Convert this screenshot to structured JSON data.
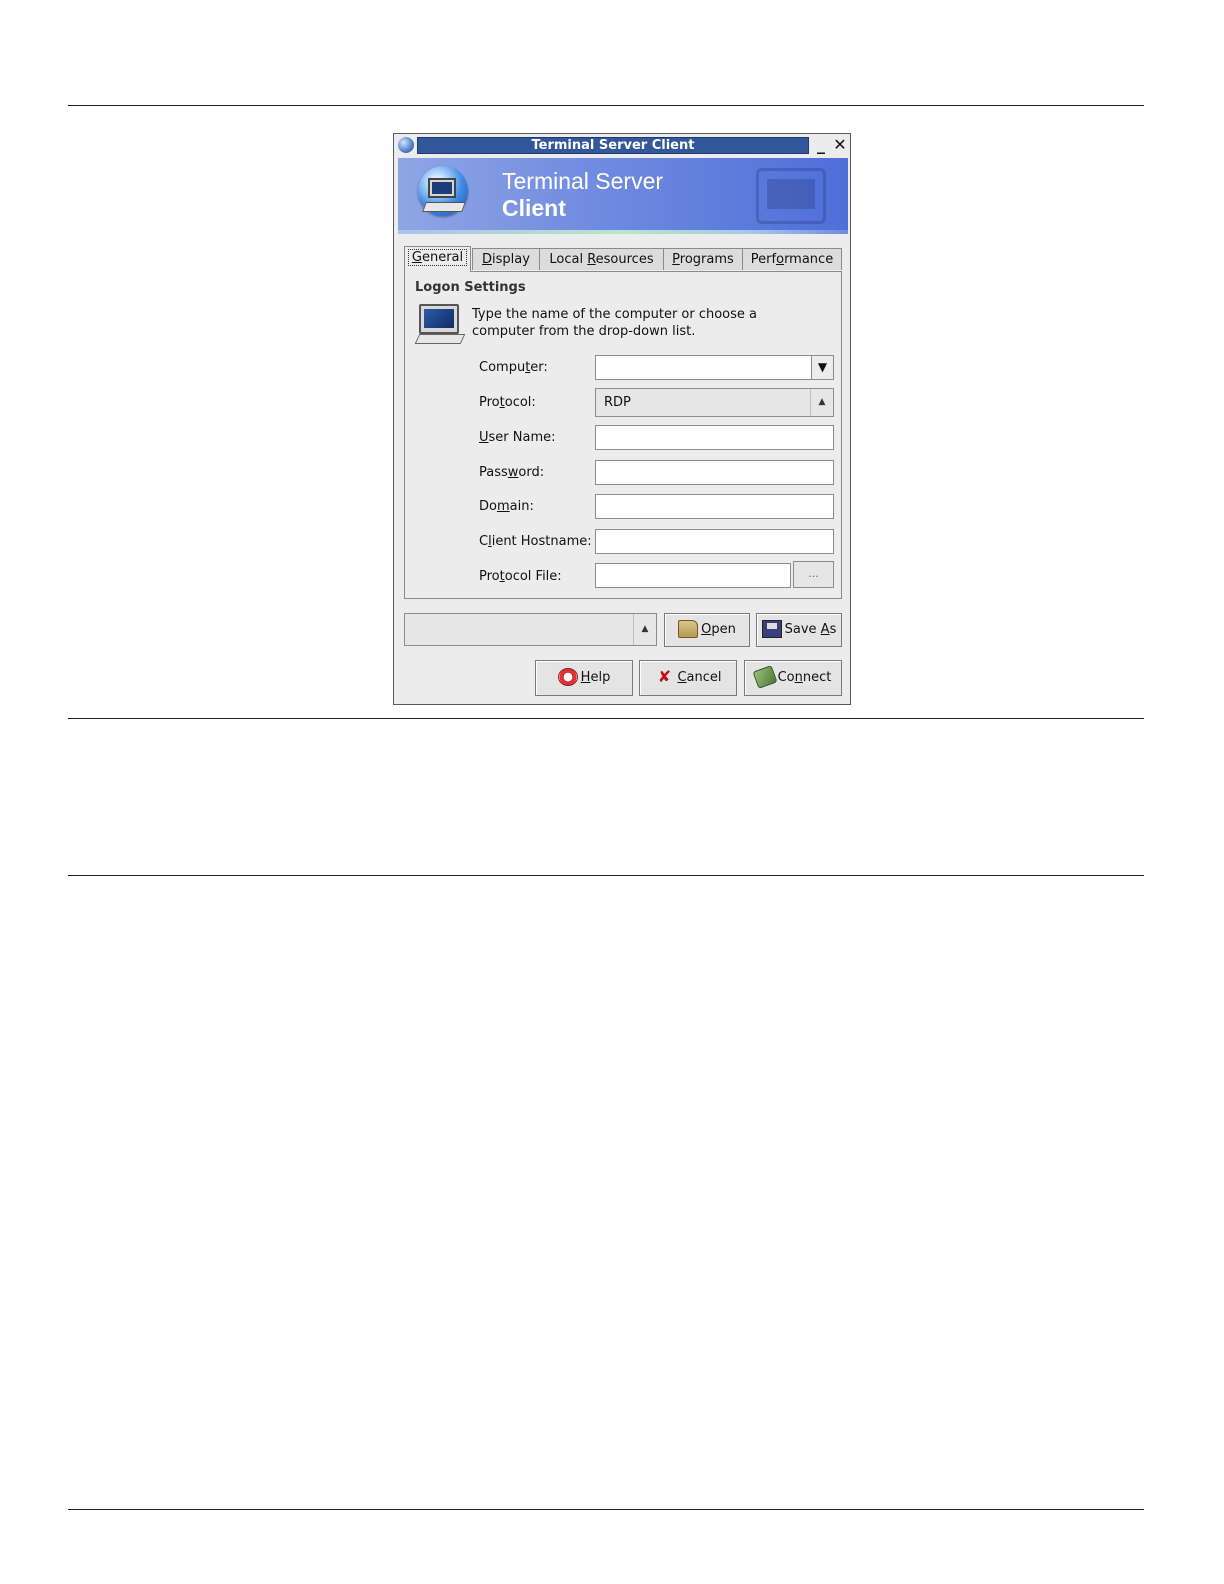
{
  "window": {
    "title": "Terminal Server Client"
  },
  "banner": {
    "line1": "Terminal Server",
    "line2": "Client"
  },
  "tabs": [
    {
      "pre": "",
      "key": "G",
      "post": "eneral",
      "active": true
    },
    {
      "pre": "",
      "key": "D",
      "post": "isplay",
      "active": false
    },
    {
      "pre": "Local ",
      "key": "R",
      "post": "esources",
      "active": false
    },
    {
      "pre": "",
      "key": "P",
      "post": "rograms",
      "active": false
    },
    {
      "pre": "Perf",
      "key": "o",
      "post": "rmance",
      "active": false
    }
  ],
  "logon": {
    "section_title": "Logon Settings",
    "description": "Type the name of the computer or choose a computer from the drop-down list."
  },
  "fields": {
    "computer": {
      "pre": "Compu",
      "key": "t",
      "post": "er:",
      "value": ""
    },
    "protocol": {
      "pre": "Pro",
      "key": "t",
      "post": "ocol:",
      "value": "RDP"
    },
    "username": {
      "pre": "",
      "key": "U",
      "post": "ser Name:",
      "value": ""
    },
    "password": {
      "pre": "Pass",
      "key": "w",
      "post": "ord:",
      "value": ""
    },
    "domain": {
      "pre": "Do",
      "key": "m",
      "post": "ain:",
      "value": ""
    },
    "client_hostname": {
      "pre": "C",
      "key": "l",
      "post": "ient Hostname:",
      "value": ""
    },
    "protocol_file": {
      "pre": "Pro",
      "key": "t",
      "post": "ocol File:",
      "value": "",
      "browse_label": "..."
    }
  },
  "buttons": {
    "open": {
      "pre": "",
      "key": "O",
      "post": "pen"
    },
    "save_as": {
      "pre": "Save ",
      "key": "A",
      "post": "s"
    },
    "help": {
      "pre": "",
      "key": "H",
      "post": "elp"
    },
    "cancel": {
      "pre": "",
      "key": "C",
      "post": "ancel"
    },
    "connect": {
      "pre": "Co",
      "key": "n",
      "post": "nect"
    }
  },
  "icons": {
    "window": "terminal-server-icon",
    "banner": "globe-computer-icon",
    "logon": "computer-icon",
    "open": "folder-open-icon",
    "save_as": "floppy-save-icon",
    "help": "lifebuoy-help-icon",
    "cancel": "cross-icon",
    "connect": "plug-connect-icon"
  },
  "colors": {
    "title_bar": "#32579b",
    "banner_gradient_start": "#8fa6e4",
    "banner_gradient_end": "#4f6fd8",
    "window_bg": "#ececec"
  }
}
